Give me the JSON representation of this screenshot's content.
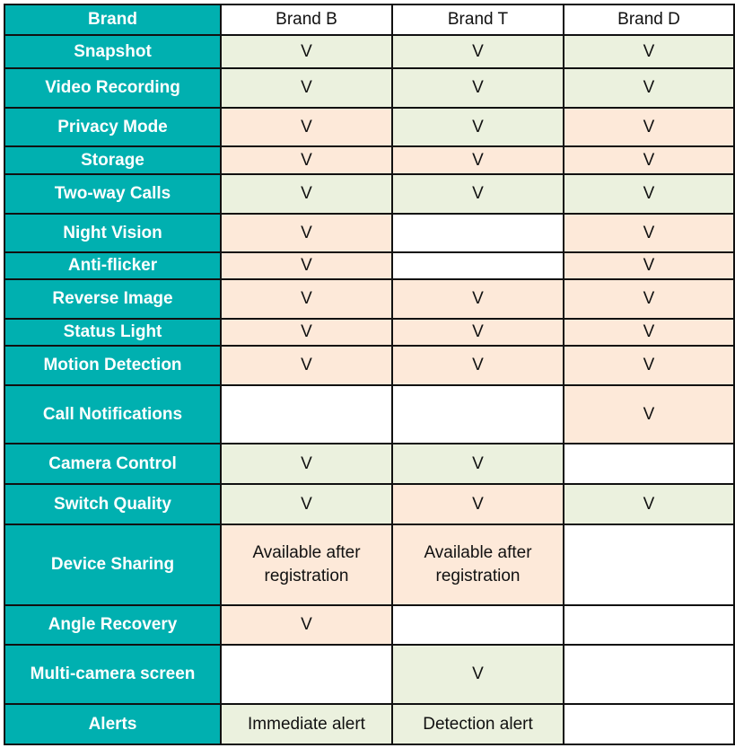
{
  "colors": {
    "feature_bg": "#00b0b0",
    "green": "#ebf1de",
    "peach": "#fde9d9",
    "white": "#ffffff"
  },
  "header": {
    "label": "Brand",
    "brands": [
      "Brand B",
      "Brand T",
      "Brand D"
    ]
  },
  "rows": [
    {
      "feature": "Snapshot",
      "cells": [
        {
          "text": "V",
          "bg": "green"
        },
        {
          "text": "V",
          "bg": "green"
        },
        {
          "text": "V",
          "bg": "green"
        }
      ]
    },
    {
      "feature": "Video Recording",
      "cells": [
        {
          "text": "V",
          "bg": "green"
        },
        {
          "text": "V",
          "bg": "green"
        },
        {
          "text": "V",
          "bg": "green"
        }
      ]
    },
    {
      "feature": "Privacy Mode",
      "cells": [
        {
          "text": "V",
          "bg": "peach"
        },
        {
          "text": "V",
          "bg": "green"
        },
        {
          "text": "V",
          "bg": "peach"
        }
      ]
    },
    {
      "feature": "Storage",
      "cells": [
        {
          "text": "V",
          "bg": "peach"
        },
        {
          "text": "V",
          "bg": "peach"
        },
        {
          "text": "V",
          "bg": "peach"
        }
      ]
    },
    {
      "feature": "Two-way Calls",
      "cells": [
        {
          "text": "V",
          "bg": "green"
        },
        {
          "text": "V",
          "bg": "green"
        },
        {
          "text": "V",
          "bg": "green"
        }
      ]
    },
    {
      "feature": "Night Vision",
      "cells": [
        {
          "text": "V",
          "bg": "peach"
        },
        {
          "text": "",
          "bg": "white"
        },
        {
          "text": "V",
          "bg": "peach"
        }
      ]
    },
    {
      "feature": "Anti-flicker",
      "cells": [
        {
          "text": "V",
          "bg": "peach"
        },
        {
          "text": "",
          "bg": "white"
        },
        {
          "text": "V",
          "bg": "peach"
        }
      ]
    },
    {
      "feature": "Reverse Image",
      "cells": [
        {
          "text": "V",
          "bg": "peach"
        },
        {
          "text": "V",
          "bg": "peach"
        },
        {
          "text": "V",
          "bg": "peach"
        }
      ]
    },
    {
      "feature": "Status Light",
      "cells": [
        {
          "text": "V",
          "bg": "peach"
        },
        {
          "text": "V",
          "bg": "peach"
        },
        {
          "text": "V",
          "bg": "peach"
        }
      ]
    },
    {
      "feature": "Motion Detection",
      "cells": [
        {
          "text": "V",
          "bg": "peach"
        },
        {
          "text": "V",
          "bg": "peach"
        },
        {
          "text": "V",
          "bg": "peach"
        }
      ]
    },
    {
      "feature": "Call Notifications",
      "cells": [
        {
          "text": "",
          "bg": "white"
        },
        {
          "text": "",
          "bg": "white"
        },
        {
          "text": "V",
          "bg": "peach"
        }
      ]
    },
    {
      "feature": "Camera Control",
      "cells": [
        {
          "text": "V",
          "bg": "green"
        },
        {
          "text": "V",
          "bg": "green"
        },
        {
          "text": "",
          "bg": "white"
        }
      ]
    },
    {
      "feature": "Switch Quality",
      "cells": [
        {
          "text": "V",
          "bg": "green"
        },
        {
          "text": "V",
          "bg": "peach"
        },
        {
          "text": "V",
          "bg": "green"
        }
      ]
    },
    {
      "feature": "Device Sharing",
      "cells": [
        {
          "text": "Available after registration",
          "bg": "peach"
        },
        {
          "text": "Available after registration",
          "bg": "peach"
        },
        {
          "text": "",
          "bg": "white"
        }
      ]
    },
    {
      "feature": "Angle Recovery",
      "cells": [
        {
          "text": "V",
          "bg": "peach"
        },
        {
          "text": "",
          "bg": "white"
        },
        {
          "text": "",
          "bg": "white"
        }
      ]
    },
    {
      "feature": "Multi-camera screen",
      "cells": [
        {
          "text": "",
          "bg": "white"
        },
        {
          "text": "V",
          "bg": "green"
        },
        {
          "text": "",
          "bg": "white"
        }
      ]
    },
    {
      "feature": "Alerts",
      "cells": [
        {
          "text": "Immediate alert",
          "bg": "green"
        },
        {
          "text": "Detection alert",
          "bg": "green"
        },
        {
          "text": "",
          "bg": "white"
        }
      ]
    }
  ]
}
